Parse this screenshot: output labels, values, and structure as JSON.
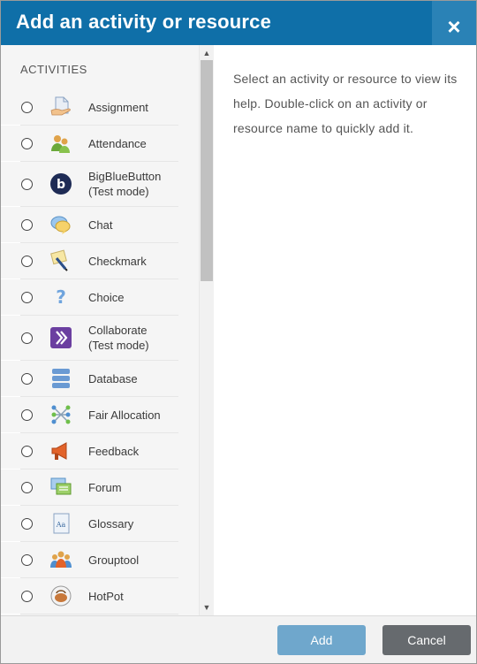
{
  "dialog": {
    "title": "Add an activity or resource",
    "close_label": "×"
  },
  "sidebar": {
    "section_label": "ACTIVITIES",
    "items": [
      {
        "label": "Assignment",
        "icon": "assignment-icon"
      },
      {
        "label": "Attendance",
        "icon": "attendance-icon"
      },
      {
        "label": "BigBlueButton\n(Test mode)",
        "icon": "bigbluebutton-icon"
      },
      {
        "label": "Chat",
        "icon": "chat-icon"
      },
      {
        "label": "Checkmark",
        "icon": "checkmark-icon"
      },
      {
        "label": "Choice",
        "icon": "choice-icon"
      },
      {
        "label": "Collaborate\n(Test mode)",
        "icon": "collaborate-icon"
      },
      {
        "label": "Database",
        "icon": "database-icon"
      },
      {
        "label": "Fair Allocation",
        "icon": "fair-allocation-icon"
      },
      {
        "label": "Feedback",
        "icon": "feedback-icon"
      },
      {
        "label": "Forum",
        "icon": "forum-icon"
      },
      {
        "label": "Glossary",
        "icon": "glossary-icon"
      },
      {
        "label": "Grouptool",
        "icon": "grouptool-icon"
      },
      {
        "label": "HotPot",
        "icon": "hotpot-icon"
      }
    ]
  },
  "help": {
    "text": "Select an activity or resource to view its help. Double-click on an activity or resource name to quickly add it."
  },
  "footer": {
    "add_label": "Add",
    "cancel_label": "Cancel"
  },
  "colors": {
    "header": "#0f6fa8",
    "add_button": "#6fa7cc",
    "cancel_button": "#666a6e"
  }
}
